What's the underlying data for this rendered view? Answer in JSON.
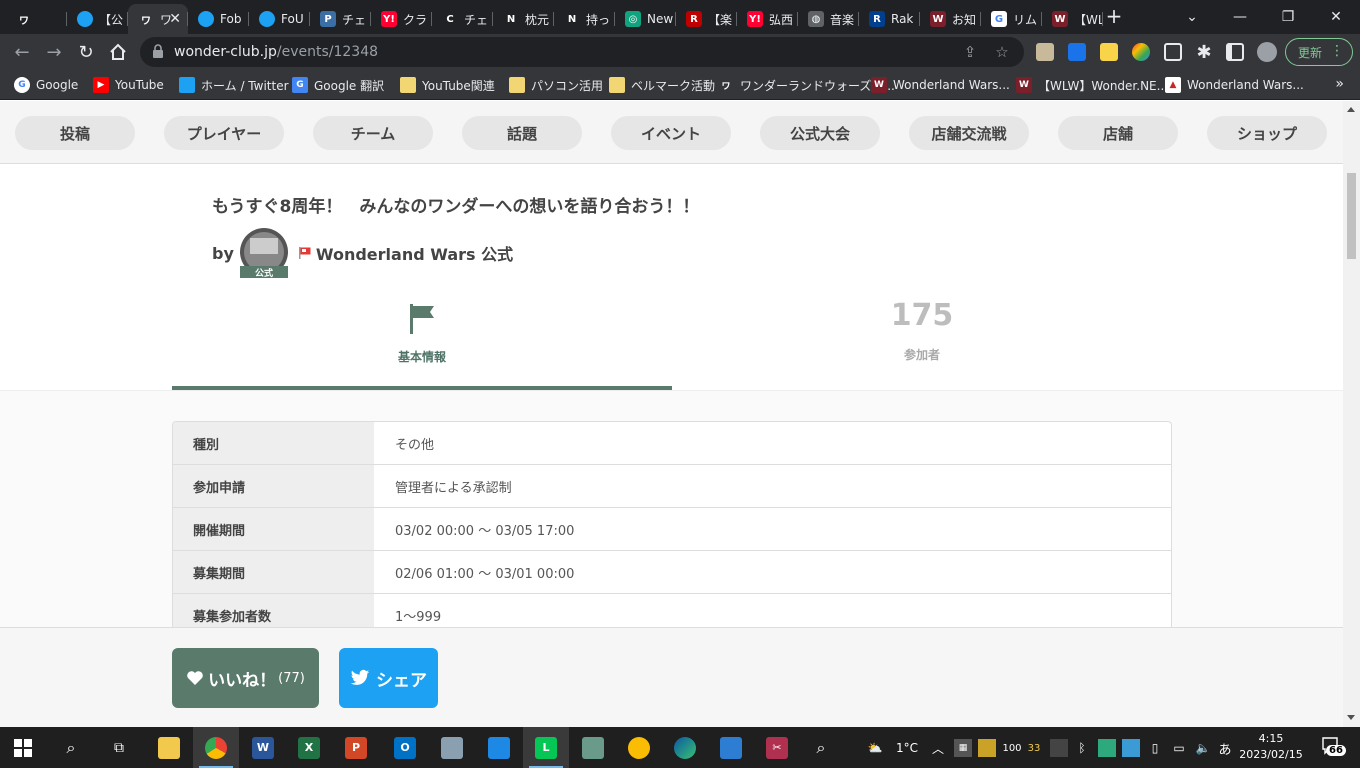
{
  "browser": {
    "tabs": [
      {
        "favicon": "wonder-club-icon",
        "title": "",
        "color": "#202124",
        "glyph": "ワ"
      },
      {
        "favicon": "twitter-icon",
        "title": "【公",
        "color": "#1da1f2",
        "glyph": ""
      },
      {
        "favicon": "wonder-club-icon",
        "title": "ワ",
        "color": "#35363a",
        "glyph": "ワ",
        "active": true
      },
      {
        "favicon": "twitter-icon",
        "title": "Fob",
        "color": "#1da1f2",
        "glyph": ""
      },
      {
        "favicon": "twitter-icon",
        "title": "FoU",
        "color": "#1da1f2",
        "glyph": ""
      },
      {
        "favicon": "p-icon",
        "title": "チェ",
        "color": "#3a6ea5",
        "glyph": "P"
      },
      {
        "favicon": "yahoo-icon",
        "title": "クラ",
        "color": "#ff0033",
        "glyph": "Y!"
      },
      {
        "favicon": "chatgpt-icon",
        "title": "チェ",
        "color": "#202124",
        "glyph": "C"
      },
      {
        "favicon": "n-icon",
        "title": "枕元",
        "color": "#202124",
        "glyph": "N"
      },
      {
        "favicon": "n-icon",
        "title": "持っ",
        "color": "#202124",
        "glyph": "N"
      },
      {
        "favicon": "openai-icon",
        "title": "New",
        "color": "#10a37f",
        "glyph": "◎"
      },
      {
        "favicon": "rakuten-icon",
        "title": "【楽",
        "color": "#bf0000",
        "glyph": "R"
      },
      {
        "favicon": "yahoo-icon",
        "title": "弘西",
        "color": "#ff0033",
        "glyph": "Y!"
      },
      {
        "favicon": "globe-icon",
        "title": "音楽",
        "color": "#5f6368",
        "glyph": "◍"
      },
      {
        "favicon": "rakuten-icon",
        "title": "Rak",
        "color": "#003f8e",
        "glyph": "R"
      },
      {
        "favicon": "wlw-icon",
        "title": "お知",
        "color": "#7b1f2a",
        "glyph": "W"
      },
      {
        "favicon": "google-icon",
        "title": "リム",
        "color": "#ffffff",
        "glyph": "G"
      },
      {
        "favicon": "wlw-icon",
        "title": "【WL",
        "color": "#7b1f2a",
        "glyph": "W"
      }
    ],
    "tab_close": "✕",
    "new_tab": "+",
    "url_host": "wonder-club.jp",
    "url_path": "/events/12348",
    "update_label": "更新",
    "bookmarks": [
      {
        "label": "Google",
        "icon": "google-icon",
        "color": "#ffffff",
        "glyph": "G"
      },
      {
        "label": "YouTube",
        "icon": "youtube-icon",
        "color": "#ff0000",
        "glyph": "▶"
      },
      {
        "label": "ホーム / Twitter",
        "icon": "twitter-icon",
        "color": "#1da1f2",
        "glyph": ""
      },
      {
        "label": "Google 翻訳",
        "icon": "translate-icon",
        "color": "#4285f4",
        "glyph": "G"
      },
      {
        "label": "YouTube関連",
        "icon": "folder-icon",
        "color": "#f2d674",
        "glyph": ""
      },
      {
        "label": "パソコン活用",
        "icon": "folder-icon",
        "color": "#f2d674",
        "glyph": ""
      },
      {
        "label": "ベルマーク活動",
        "icon": "folder-icon",
        "color": "#f2d674",
        "glyph": ""
      },
      {
        "label": "ワンダーランドウォーズの...",
        "icon": "wonder-club-icon",
        "color": "#35363a",
        "glyph": "ワ"
      },
      {
        "label": "Wonderland Wars...",
        "icon": "wlw-icon",
        "color": "#7b1f2a",
        "glyph": "W"
      },
      {
        "label": "【WLW】Wonder.NE...",
        "icon": "wlw-icon",
        "color": "#7b1f2a",
        "glyph": "W"
      },
      {
        "label": "Wonderland Wars...",
        "icon": "wlw-red-icon",
        "color": "#ffffff",
        "glyph": "▲"
      }
    ],
    "bookmarks_more": "»"
  },
  "site": {
    "nav": [
      "投稿",
      "プレイヤー",
      "チーム",
      "話題",
      "イベント",
      "公式大会",
      "店舗交流戦",
      "店舗",
      "ショップ"
    ],
    "event_title": "もうすぐ8周年！　みんなのワンダーへの想いを語り合おう！！",
    "by_label": "by",
    "avatar_badge": "公式",
    "organizer": "Wonderland Wars 公式",
    "tabs": {
      "info_label": "基本情報",
      "members_count": "175",
      "members_label": "参加者"
    },
    "info_rows": [
      {
        "key": "種別",
        "value": "その他"
      },
      {
        "key": "参加申請",
        "value": "管理者による承認制"
      },
      {
        "key": "開催期間",
        "value": "03/02 00:00 〜 03/05 17:00"
      },
      {
        "key": "募集期間",
        "value": "02/06 01:00 〜 03/01 00:00"
      },
      {
        "key": "募集参加者数",
        "value": "1〜999"
      }
    ],
    "like_label": "いいね！",
    "like_count": "(77)",
    "share_label": "シェア",
    "accent_color": "#5a7a6c",
    "twitter_color": "#1da1f2"
  },
  "taskbar": {
    "weather_temp": "1°C",
    "ime": "あ",
    "tray_num1": "100",
    "tray_num2": "33",
    "time": "4:15",
    "date": "2023/02/15",
    "notifications": "66"
  }
}
